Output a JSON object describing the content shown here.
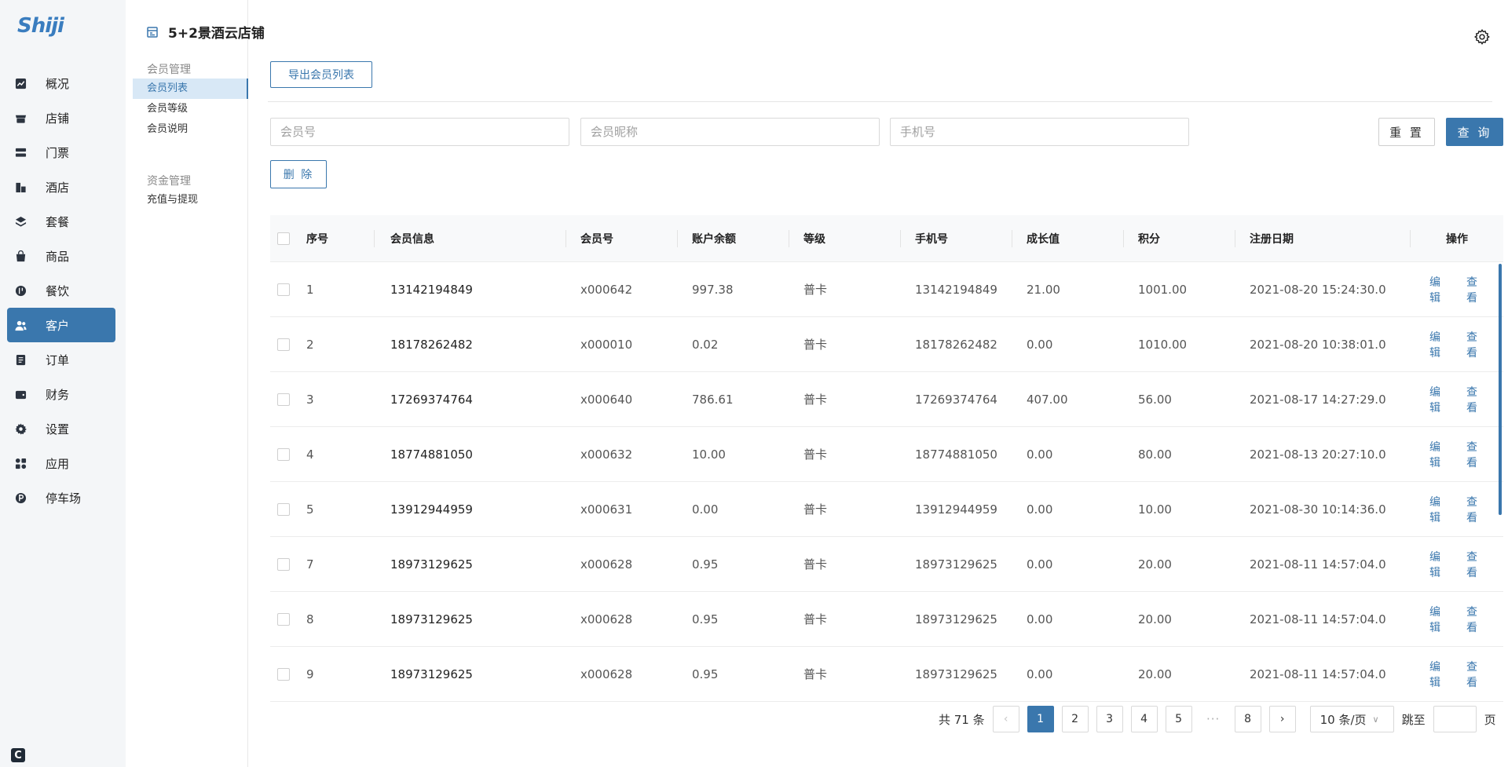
{
  "app": {
    "logo": "Shiji",
    "store_name": "5+2景酒云店铺"
  },
  "sidebar": {
    "items": [
      {
        "label": "概况",
        "icon": "chart-icon"
      },
      {
        "label": "店铺",
        "icon": "shop-icon"
      },
      {
        "label": "门票",
        "icon": "ticket-icon"
      },
      {
        "label": "酒店",
        "icon": "hotel-icon"
      },
      {
        "label": "套餐",
        "icon": "layers-icon"
      },
      {
        "label": "商品",
        "icon": "bag-icon"
      },
      {
        "label": "餐饮",
        "icon": "food-icon"
      },
      {
        "label": "客户",
        "icon": "users-icon",
        "active": true
      },
      {
        "label": "订单",
        "icon": "order-icon"
      },
      {
        "label": "财务",
        "icon": "wallet-icon"
      },
      {
        "label": "设置",
        "icon": "gear-icon"
      },
      {
        "label": "应用",
        "icon": "apps-icon"
      },
      {
        "label": "停车场",
        "icon": "parking-icon"
      }
    ],
    "bottom_icon": "C"
  },
  "subnav": {
    "groups": [
      {
        "title": "会员管理",
        "items": [
          "会员列表",
          "会员等级",
          "会员说明"
        ],
        "active": "会员列表"
      },
      {
        "title": "资金管理",
        "items": [
          "充值与提现"
        ]
      }
    ]
  },
  "toolbar": {
    "export_label": "导出会员列表",
    "delete_label": "删 除",
    "reset_label": "重 置",
    "query_label": "查 询"
  },
  "filters": {
    "member_no_placeholder": "会员号",
    "nickname_placeholder": "会员昵称",
    "phone_placeholder": "手机号"
  },
  "table": {
    "headers": [
      "序号",
      "会员信息",
      "会员号",
      "账户余额",
      "等级",
      "手机号",
      "成长值",
      "积分",
      "注册日期",
      "操作"
    ],
    "edit_label": "编辑",
    "view_label": "查看",
    "rows": [
      {
        "idx": "1",
        "info": "13142194849",
        "member_no": "x000642",
        "balance": "997.38",
        "level": "普卡",
        "phone": "13142194849",
        "growth": "21.00",
        "points": "1001.00",
        "date": "2021-08-20 15:24:30.0"
      },
      {
        "idx": "2",
        "info": "18178262482",
        "member_no": "x000010",
        "balance": "0.02",
        "level": "普卡",
        "phone": "18178262482",
        "growth": "0.00",
        "points": "1010.00",
        "date": "2021-08-20 10:38:01.0"
      },
      {
        "idx": "3",
        "info": "17269374764",
        "member_no": "x000640",
        "balance": "786.61",
        "level": "普卡",
        "phone": "17269374764",
        "growth": "407.00",
        "points": "56.00",
        "date": "2021-08-17 14:27:29.0"
      },
      {
        "idx": "4",
        "info": "18774881050",
        "member_no": "x000632",
        "balance": "10.00",
        "level": "普卡",
        "phone": "18774881050",
        "growth": "0.00",
        "points": "80.00",
        "date": "2021-08-13 20:27:10.0"
      },
      {
        "idx": "5",
        "info": "13912944959",
        "member_no": "x000631",
        "balance": "0.00",
        "level": "普卡",
        "phone": "13912944959",
        "growth": "0.00",
        "points": "10.00",
        "date": "2021-08-30 10:14:36.0"
      },
      {
        "idx": "7",
        "info": "18973129625",
        "member_no": "x000628",
        "balance": "0.95",
        "level": "普卡",
        "phone": "18973129625",
        "growth": "0.00",
        "points": "20.00",
        "date": "2021-08-11 14:57:04.0"
      },
      {
        "idx": "8",
        "info": "18973129625",
        "member_no": "x000628",
        "balance": "0.95",
        "level": "普卡",
        "phone": "18973129625",
        "growth": "0.00",
        "points": "20.00",
        "date": "2021-08-11 14:57:04.0"
      },
      {
        "idx": "9",
        "info": "18973129625",
        "member_no": "x000628",
        "balance": "0.95",
        "level": "普卡",
        "phone": "18973129625",
        "growth": "0.00",
        "points": "20.00",
        "date": "2021-08-11 14:57:04.0"
      }
    ]
  },
  "pagination": {
    "total_text": "共 71 条",
    "pages": [
      "1",
      "2",
      "3",
      "4",
      "5",
      "8"
    ],
    "current": "1",
    "ellipsis": "···",
    "page_size": "10 条/页",
    "jump_prefix": "跳至",
    "jump_suffix": "页"
  },
  "colors": {
    "accent": "#3a77ad",
    "sidebar_bg": "#f4f6f8"
  }
}
